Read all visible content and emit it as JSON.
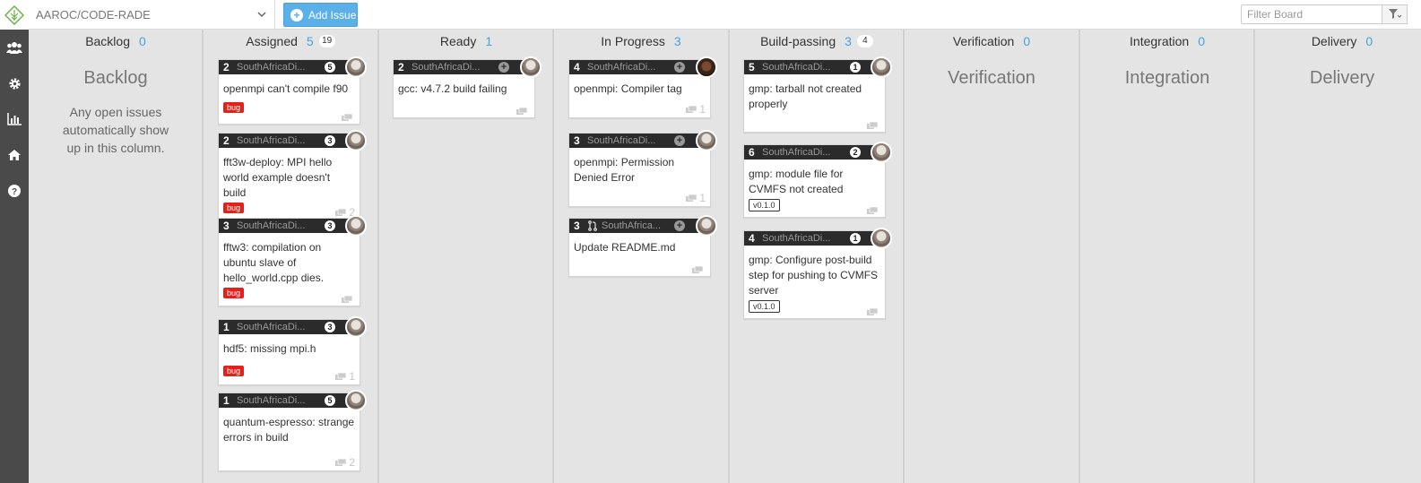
{
  "header": {
    "repo": "AAROC/CODE-RADE",
    "add_issue": "Add Issue",
    "filter_placeholder": "Filter Board"
  },
  "sidebar": {
    "items": [
      "people-icon",
      "gear-icon",
      "bar-chart-icon",
      "home-icon",
      "help-icon"
    ]
  },
  "colors": {
    "accent": "#45a3e0",
    "sidebar": "#4a4a4a",
    "card_header": "#2b2b2b",
    "bug_label": "#e3201b",
    "add_button": "#5bb0e8"
  },
  "columns": {
    "backlog": {
      "name": "Backlog",
      "count": "0",
      "empty_title": "Backlog",
      "empty_text": "Any open issues automatically show up in this column."
    },
    "assigned": {
      "name": "Assigned",
      "count": "5",
      "badge": "19"
    },
    "ready": {
      "name": "Ready",
      "count": "1"
    },
    "in_progress": {
      "name": "In Progress",
      "count": "3"
    },
    "build_passing": {
      "name": "Build-passing",
      "count": "3",
      "badge": "4"
    },
    "verification": {
      "name": "Verification",
      "count": "0",
      "empty_title": "Verification"
    },
    "integration": {
      "name": "Integration",
      "count": "0",
      "empty_title": "Integration"
    },
    "delivery": {
      "name": "Delivery",
      "count": "0",
      "empty_title": "Delivery"
    }
  },
  "cards": {
    "a1": {
      "num": "2",
      "repo": "SouthAfricaDi...",
      "circle": "5",
      "title": "openmpi can't compile f90",
      "label": "bug",
      "comments": ""
    },
    "a2": {
      "num": "2",
      "repo": "SouthAfricaDi...",
      "circle": "3",
      "title": "fft3w-deploy: MPI hello world example doesn't build",
      "label": "bug",
      "comments": "2"
    },
    "a3": {
      "num": "3",
      "repo": "SouthAfricaDi...",
      "circle": "3",
      "title": "fftw3: compilation on ubuntu slave of hello_world.cpp dies.",
      "label": "bug",
      "comments": ""
    },
    "a4": {
      "num": "1",
      "repo": "SouthAfricaDi...",
      "circle": "3",
      "title": "hdf5: missing mpi.h",
      "label": "bug",
      "comments": "1"
    },
    "a5": {
      "num": "1",
      "repo": "SouthAfricaDi...",
      "circle": "5",
      "title": "quantum-espresso: strange errors in build",
      "comments": "2"
    },
    "r1": {
      "num": "2",
      "repo": "SouthAfricaDi...",
      "title": "gcc: v4.7.2 build failing",
      "comments": ""
    },
    "p1": {
      "num": "4",
      "repo": "SouthAfricaDi...",
      "title": "openmpi: Compiler tag",
      "comments": "1"
    },
    "p2": {
      "num": "3",
      "repo": "SouthAfricaDi...",
      "title": "openmpi: Permission Denied Error",
      "comments": "1"
    },
    "p3": {
      "num": "3",
      "repo": "SouthAfrica...",
      "title": "Update README.md",
      "comments": ""
    },
    "b1": {
      "num": "5",
      "repo": "SouthAfricaDi...",
      "circle": "1",
      "title": "gmp: tarball not created properly",
      "comments": ""
    },
    "b2": {
      "num": "6",
      "repo": "SouthAfricaDi...",
      "circle": "2",
      "title": "gmp: module file for CVMFS not created",
      "label": "v0.1.0",
      "comments": ""
    },
    "b3": {
      "num": "4",
      "repo": "SouthAfricaDi...",
      "circle": "1",
      "title": "gmp: Configure post-build step for pushing to CVMFS server",
      "label": "v0.1.0",
      "comments": ""
    }
  }
}
